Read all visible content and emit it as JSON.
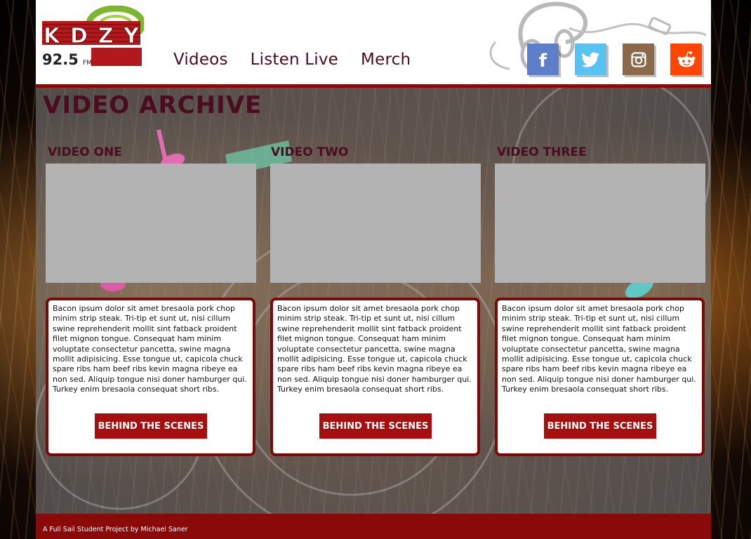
{
  "brand": {
    "logo_letters": "KDZY",
    "logo_frequency": "92.5",
    "logo_band": "FM",
    "colors": {
      "primary": "#8a0a0a",
      "accent_text": "#4a0c1e",
      "button": "#a50f0f"
    }
  },
  "nav": {
    "items": [
      {
        "label": "Videos"
      },
      {
        "label": "Listen Live"
      },
      {
        "label": "Merch"
      }
    ]
  },
  "social": [
    {
      "name": "facebook",
      "icon": "facebook-icon",
      "glyph": "f",
      "color": "#5d7fc9"
    },
    {
      "name": "twitter",
      "icon": "twitter-icon",
      "glyph": "",
      "color": "#58c3f2"
    },
    {
      "name": "instagram",
      "icon": "instagram-icon",
      "glyph": "",
      "color": "#8a6a4a"
    },
    {
      "name": "reddit",
      "icon": "reddit-icon",
      "glyph": "",
      "color": "#ff4500"
    }
  ],
  "main": {
    "title": "VIDEO  ARCHIVE",
    "videos": [
      {
        "label": "VIDEO ONE",
        "description": "Bacon ipsum dolor sit amet bresaola pork chop minim strip steak. Tri-tip et sunt ut, nisi cillum swine reprehenderit mollit sint fatback proident filet mignon tongue. Consequat ham minim voluptate consectetur pancetta, swine magna mollit adipisicing. Esse tongue ut, capicola chuck spare ribs ham beef ribs kevin magna ribeye ea non sed. Aliquip tongue nisi doner hamburger qui. Turkey enim bresaola consequat short ribs.",
        "button": "BEHIND THE SCENES"
      },
      {
        "label": "VIDEO TWO",
        "description": "Bacon ipsum dolor sit amet bresaola pork chop minim strip steak. Tri-tip et sunt ut, nisi cillum swine reprehenderit mollit sint fatback proident filet mignon tongue. Consequat ham minim voluptate consectetur pancetta, swine magna mollit adipisicing. Esse tongue ut, capicola chuck spare ribs ham beef ribs kevin magna ribeye ea non sed. Aliquip tongue nisi doner hamburger qui. Turkey enim bresaola consequat short ribs.",
        "button": "BEHIND THE SCENES"
      },
      {
        "label": "VIDEO THREE",
        "description": "Bacon ipsum dolor sit amet bresaola pork chop minim strip steak. Tri-tip et sunt ut, nisi cillum swine reprehenderit mollit sint fatback proident filet mignon tongue. Consequat ham minim voluptate consectetur pancetta, swine magna mollit adipisicing. Esse tongue ut, capicola chuck spare ribs ham beef ribs kevin magna ribeye ea non sed. Aliquip tongue nisi doner hamburger qui. Turkey enim bresaola consequat short ribs.",
        "button": "BEHIND THE SCENES"
      }
    ]
  },
  "footer": {
    "text": "A Full Sail Student Project by Michael Saner"
  }
}
